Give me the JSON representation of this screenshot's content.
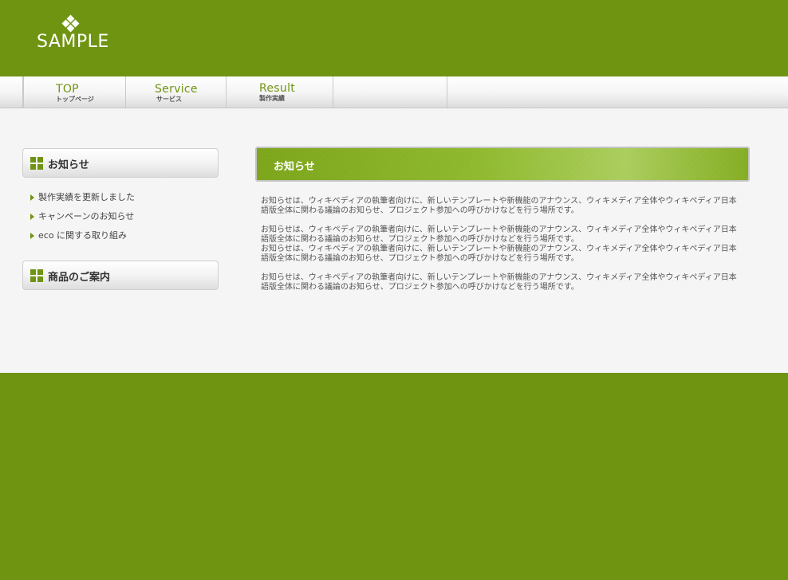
{
  "header": {
    "logo_text": "SAMPLE"
  },
  "nav": {
    "items": [
      {
        "en": "TOP",
        "jp": "トップページ"
      },
      {
        "en": "Service",
        "jp": "サービス"
      },
      {
        "en": "Result",
        "jp": "製作実績"
      }
    ]
  },
  "sidebar": {
    "news_title": "お知らせ",
    "news_items": [
      "製作実績を更新しました",
      "キャンペーンのお知らせ",
      "eco に関する取り組み"
    ],
    "products_title": "商品のご案内"
  },
  "content": {
    "title": "お知らせ",
    "paragraphs": [
      "お知らせは、ウィキペディアの執筆者向けに、新しいテンプレートや新機能のアナウンス、ウィキメディア全体やウィキペディア日本語版全体に関わる議論のお知らせ、プロジェクト参加への呼びかけなどを行う場所です。",
      "お知らせは、ウィキペディアの執筆者向けに、新しいテンプレートや新機能のアナウンス、ウィキメディア全体やウィキペディア日本語版全体に関わる議論のお知らせ、プロジェクト参加への呼びかけなどを行う場所です。",
      "お知らせは、ウィキペディアの執筆者向けに、新しいテンプレートや新機能のアナウンス、ウィキメディア全体やウィキペディア日本語版全体に関わる議論のお知らせ、プロジェクト参加への呼びかけなどを行う場所です。",
      "お知らせは、ウィキペディアの執筆者向けに、新しいテンプレートや新機能のアナウンス、ウィキメディア全体やウィキペディア日本語版全体に関わる議論のお知らせ、プロジェクト参加への呼びかけなどを行う場所です。"
    ]
  },
  "colors": {
    "brand_green": "#6f9412",
    "page_bg": "#f5f5f5"
  },
  "icons": [
    "diamond-logo-icon",
    "grid-icon",
    "arrow-bullet-icon"
  ]
}
